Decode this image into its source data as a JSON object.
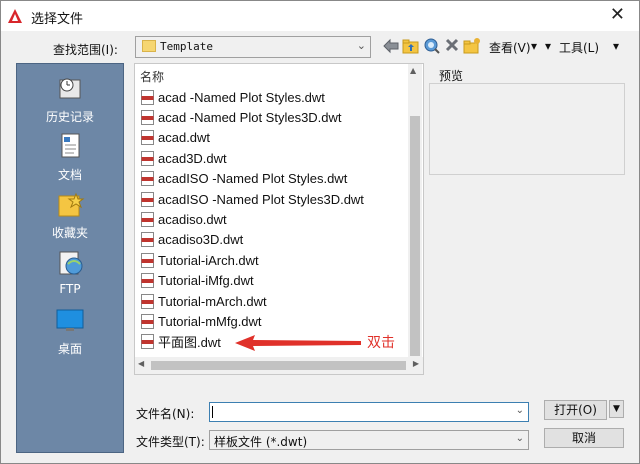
{
  "window": {
    "title": "选择文件",
    "close_glyph": "✕"
  },
  "toolbar": {
    "look_in_label": "查找范围(I):",
    "look_in_value": "Template",
    "views_label": "查看(V)",
    "tools_label": "工具(L)",
    "icons": [
      "back-arrow-icon",
      "folder-up-icon",
      "search-web-icon",
      "delete-icon",
      "new-folder-icon"
    ]
  },
  "places": [
    {
      "label": "历史记录",
      "icon": "history-icon"
    },
    {
      "label": "文档",
      "icon": "documents-icon"
    },
    {
      "label": "收藏夹",
      "icon": "favorites-icon"
    },
    {
      "label": "FTP",
      "icon": "ftp-icon"
    },
    {
      "label": "桌面",
      "icon": "desktop-icon"
    }
  ],
  "file_list": {
    "column_header": "名称",
    "files": [
      "acad -Named Plot Styles.dwt",
      "acad -Named Plot Styles3D.dwt",
      "acad.dwt",
      "acad3D.dwt",
      "acadISO -Named Plot Styles.dwt",
      "acadISO -Named Plot Styles3D.dwt",
      "acadiso.dwt",
      "acadiso3D.dwt",
      "Tutorial-iArch.dwt",
      "Tutorial-iMfg.dwt",
      "Tutorial-mArch.dwt",
      "Tutorial-mMfg.dwt",
      "平面图.dwt"
    ]
  },
  "annotation": {
    "text": "双击",
    "color": "#e0312a"
  },
  "preview": {
    "label": "预览"
  },
  "file_name": {
    "label": "文件名(N):",
    "value": ""
  },
  "file_type": {
    "label": "文件类型(T):",
    "value": "样板文件 (*.dwt)"
  },
  "buttons": {
    "open": "打开(O)",
    "cancel": "取消"
  },
  "colors": {
    "places_bg": "#6d87a6",
    "accent": "#3c7fb1",
    "annotation": "#e0312a"
  }
}
